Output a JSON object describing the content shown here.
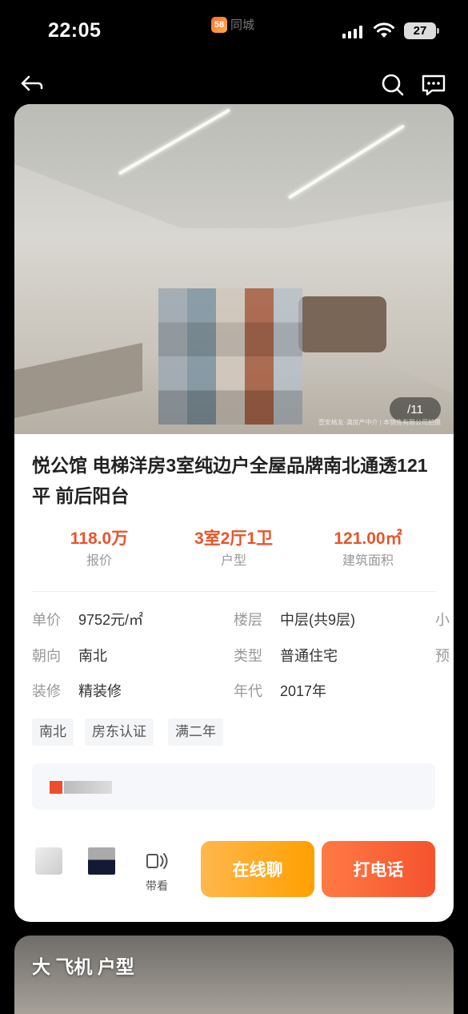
{
  "status_bar": {
    "time": "22:05",
    "app_badge": "58",
    "app_name": "同城",
    "battery": "27"
  },
  "nav": {
    "back_icon": "back-arrow-icon",
    "search_icon": "search-icon",
    "message_icon": "chat-bubble-icon"
  },
  "gallery": {
    "counter": "/11",
    "watermark": "安居客",
    "credit": "壹安格友·满房产中介 | 本销售有限公司拍摄"
  },
  "listing": {
    "title": "悦公馆 电梯洋房3室纯边户全屋品牌南北通透121平 前后阳台",
    "stats": [
      {
        "value": "118.0万",
        "label": "报价"
      },
      {
        "value": "3室2厅1卫",
        "label": "户型"
      },
      {
        "value": "121.00㎡",
        "label": "建筑面积"
      }
    ],
    "attributes": {
      "unit_price_label": "单价",
      "unit_price": "9752元/㎡",
      "floor_label": "楼层",
      "floor": "中层(共9层)",
      "orientation_label": "朝向",
      "orientation": "南北",
      "type_label": "类型",
      "type": "普通住宅",
      "decoration_label": "装修",
      "decoration": "精装修",
      "year_label": "年代",
      "year": "2017年",
      "col3_row1": "小",
      "col3_row2": "预"
    },
    "tags": [
      "南北",
      "房东认证",
      "满二年"
    ]
  },
  "actions": {
    "view_label": "带看",
    "chat_button": "在线聊",
    "call_button": "打电话"
  },
  "next_card": {
    "title": "大 飞机 户型"
  },
  "colors": {
    "accent": "#e8542a",
    "chat_button": "#ffa000",
    "call_button": "#f5532d"
  }
}
